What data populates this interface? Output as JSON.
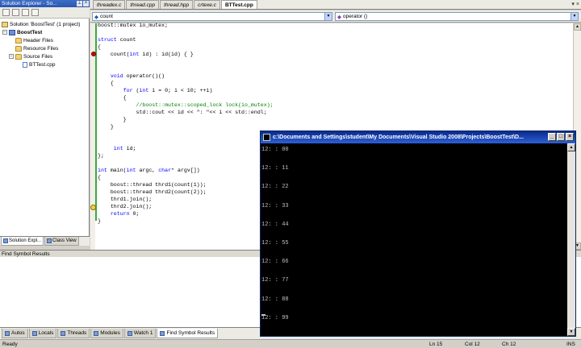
{
  "solution_explorer": {
    "title": "Solution Explorer - So...",
    "tree": [
      {
        "label": "Solution 'BoostTest' (1 project)",
        "icon": "solution-icon"
      },
      {
        "label": "BoostTest",
        "icon": "project-icon"
      },
      {
        "label": "Header Files",
        "icon": "folder-icon"
      },
      {
        "label": "Resource Files",
        "icon": "folder-icon"
      },
      {
        "label": "Source Files",
        "icon": "folder-icon"
      },
      {
        "label": "BTTest.cpp",
        "icon": "cpp-file-icon"
      }
    ],
    "bottom_tabs": [
      "Solution Expl...",
      "Class View"
    ]
  },
  "document_tabs": [
    {
      "label": "threadex.c",
      "active": false
    },
    {
      "label": "thread.cpp",
      "active": false
    },
    {
      "label": "thread.hpp",
      "active": false
    },
    {
      "label": "crtexe.c",
      "active": false
    },
    {
      "label": "BTTest.cpp",
      "active": true
    }
  ],
  "navigation": {
    "scope": "count",
    "member": "operator ()"
  },
  "code_lines": [
    "boost::mutex io_mutex;",
    "",
    "struct count",
    "{",
    "    count(int id) : id(id) { }",
    "",
    "",
    "    void operator()()",
    "    {",
    "        for (int i = 0; i < 10; ++i)",
    "        {",
    "            //boost::mutex::scoped_lock lock(io_mutex);",
    "            std::cout << id << \": \"<< i << std::endl;",
    "        }",
    "    }",
    "",
    "",
    "     int id;",
    "};",
    "",
    "int main(int argc, char* argv[])",
    "{",
    "    boost::thread thrd1(count(1));",
    "    boost::thread thrd2(count(2));",
    "    thrd1.join();",
    "    thrd2.join();",
    "    return 0;",
    "}"
  ],
  "find_symbol": {
    "title": "Find Symbol Results"
  },
  "bottom_tabs": [
    "Autos",
    "Locals",
    "Threads",
    "Modules",
    "Watch 1",
    "Find Symbol Results"
  ],
  "status": {
    "left": "Ready",
    "ln": "Ln 15",
    "col": "Col 12",
    "ch": "Ch 12",
    "mode": "INS"
  },
  "console": {
    "title": "c:\\Documents and Settings\\student\\My Documents\\Visual Studio 2008\\Projects\\BoostTest\\D...",
    "lines": [
      "12: : 00",
      "12: : 11",
      "12: : 22",
      "12: : 33",
      "12: : 44",
      "12: : 55",
      "12: : 66",
      "12: : 77",
      "12: : 88",
      "12: : 99"
    ],
    "buttons": [
      "_",
      "□",
      "×"
    ]
  },
  "colors": {
    "keyword": "#0000ff",
    "comment": "#008000",
    "title_bar": "#0a246a",
    "change_bar": "#3ca840"
  }
}
